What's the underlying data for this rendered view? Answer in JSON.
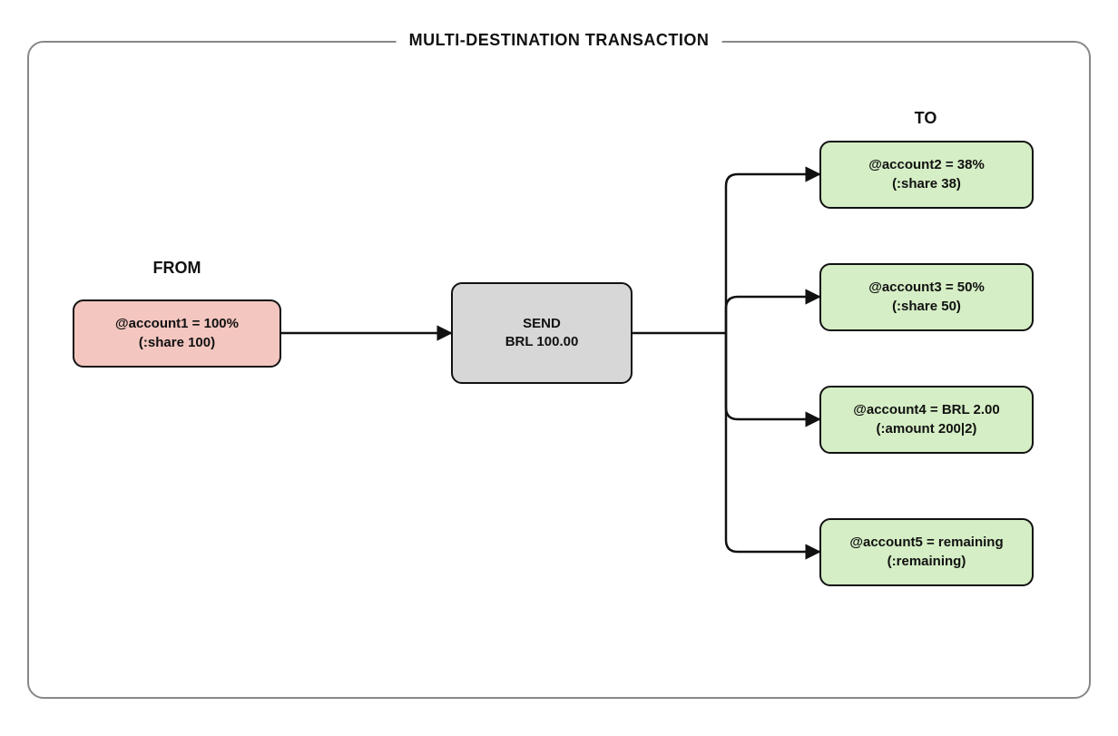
{
  "title": "MULTI-DESTINATION TRANSACTION",
  "labels": {
    "from": "FROM",
    "to": "TO"
  },
  "from": {
    "line1": "@account1 = 100%",
    "line2": "(:share 100)"
  },
  "send": {
    "line1": "SEND",
    "line2": "BRL 100.00"
  },
  "to": [
    {
      "line1": "@account2 = 38%",
      "line2": "(:share 38)"
    },
    {
      "line1": "@account3 = 50%",
      "line2": "(:share 50)"
    },
    {
      "line1": "@account4 = BRL 2.00",
      "line2": "(:amount 200|2)"
    },
    {
      "line1": "@account5 = remaining",
      "line2": "(:remaining)"
    }
  ],
  "chart_data": {
    "type": "diagram",
    "title": "MULTI-DESTINATION TRANSACTION",
    "operation": "SEND",
    "asset": "BRL",
    "amount": 100.0,
    "from": [
      {
        "account": "@account1",
        "allocation": ":share 100",
        "display": "100%"
      }
    ],
    "to": [
      {
        "account": "@account2",
        "allocation": ":share 38",
        "display": "38%"
      },
      {
        "account": "@account3",
        "allocation": ":share 50",
        "display": "50%"
      },
      {
        "account": "@account4",
        "allocation": ":amount 200|2",
        "display": "BRL 2.00"
      },
      {
        "account": "@account5",
        "allocation": ":remaining",
        "display": "remaining"
      }
    ]
  }
}
